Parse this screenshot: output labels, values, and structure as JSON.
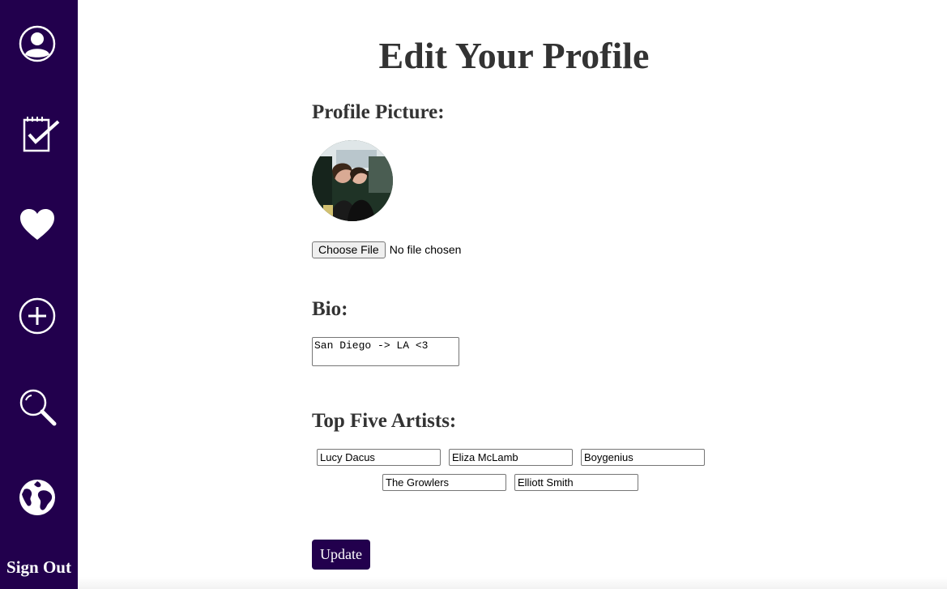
{
  "sidebar": {
    "items": [
      {
        "icon": "profile-icon"
      },
      {
        "icon": "checklist-icon"
      },
      {
        "icon": "heart-icon"
      },
      {
        "icon": "add-icon"
      },
      {
        "icon": "search-icon"
      },
      {
        "icon": "globe-icon"
      }
    ],
    "signout_label": "Sign Out"
  },
  "colors": {
    "accent": "#22004d",
    "heading": "#333333"
  },
  "page": {
    "title": "Edit Your Profile"
  },
  "profile_picture": {
    "heading": "Profile Picture:",
    "choose_file_label": "Choose File",
    "file_status": "No file chosen"
  },
  "bio": {
    "heading": "Bio:",
    "value": "San Diego -> LA <3"
  },
  "artists": {
    "heading": "Top Five Artists:",
    "values": [
      "Lucy Dacus",
      "Eliza McLamb",
      "Boygenius",
      "The Growlers",
      "Elliott Smith"
    ]
  },
  "update_label": "Update"
}
